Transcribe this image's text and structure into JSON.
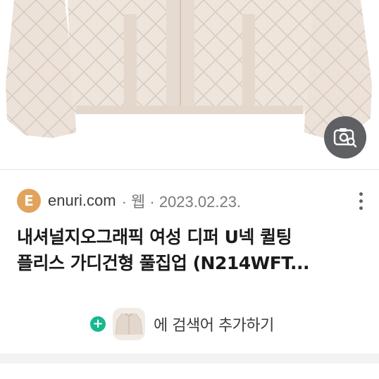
{
  "result": {
    "source_initial": "E",
    "domain": "enuri.com",
    "meta": "· 웹 · 2023.02.23.",
    "title_line1": "내셔널지오그래픽 여성 디퍼 U넥 퀼팅",
    "title_line2": "플리스 가디건형 풀집업 (N214WFT..."
  },
  "add_search": {
    "label": "에 검색어 추가하기"
  },
  "icons": {
    "lens": "visual-search-icon",
    "more": "more-vert-icon",
    "plus": "plus-circle-icon"
  },
  "colors": {
    "favicon": "#e2a35c",
    "plus": "#17b890",
    "lens_bg": "#5f6063",
    "jacket": "#eadfd6"
  }
}
